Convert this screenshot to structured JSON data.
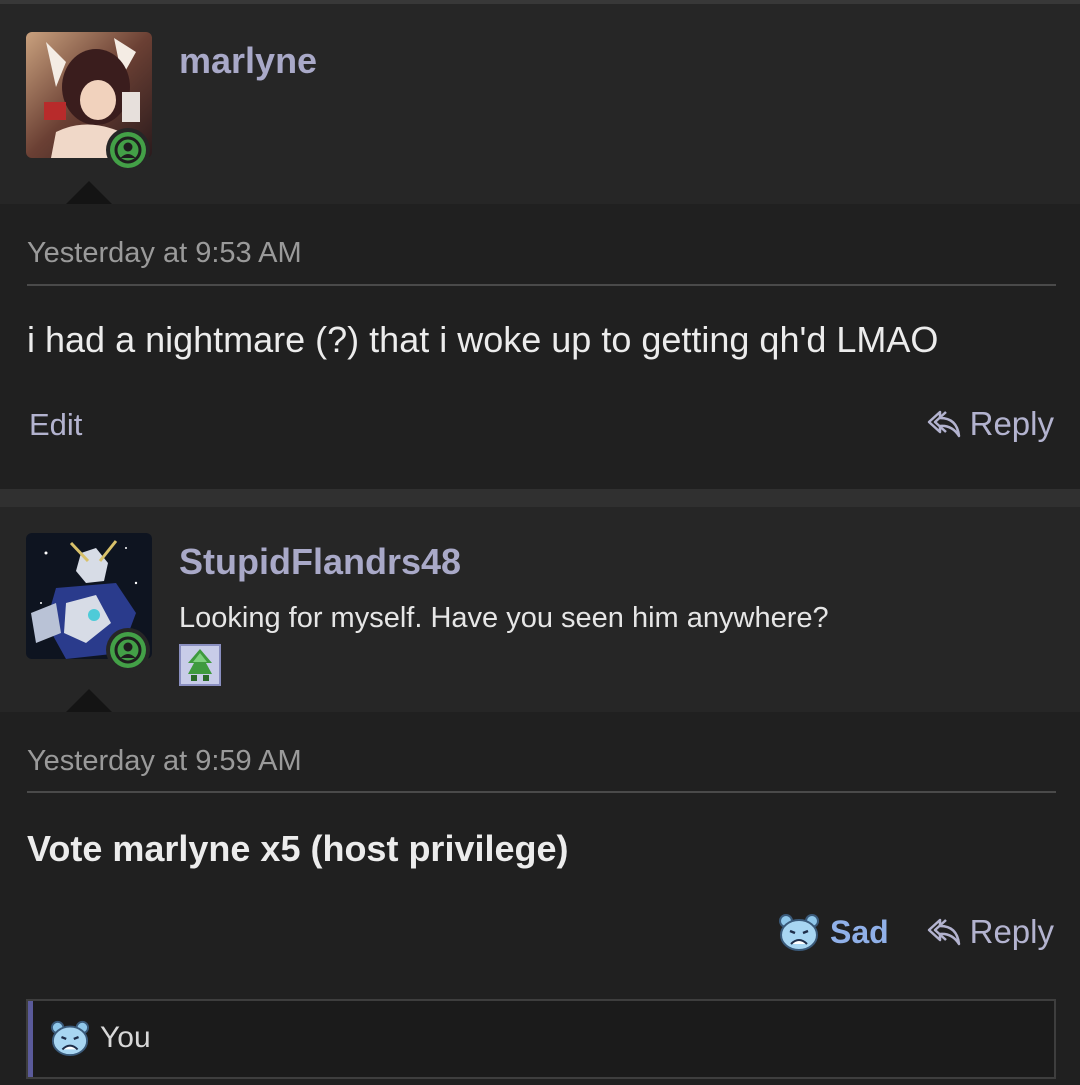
{
  "posts": [
    {
      "username": "marlyne",
      "signature": "",
      "timestamp": "Yesterday at 9:53 AM",
      "message": "i had a nightmare (?) that i woke up to getting qh'd LMAO",
      "edit_label": "Edit",
      "reply_label": "Reply"
    },
    {
      "username": "StupidFlandrs48",
      "signature": "Looking for myself. Have you seen him anywhere?",
      "timestamp": "Yesterday at 9:59 AM",
      "message": "Vote marlyne x5 (host privilege)",
      "reaction_label": "Sad",
      "reply_label": "Reply",
      "reacted_by": "You"
    }
  ],
  "colors": {
    "username": "#a9a9c8",
    "link": "#b3b3cf",
    "reaction": "#90b0e8",
    "online": "#43a047"
  }
}
